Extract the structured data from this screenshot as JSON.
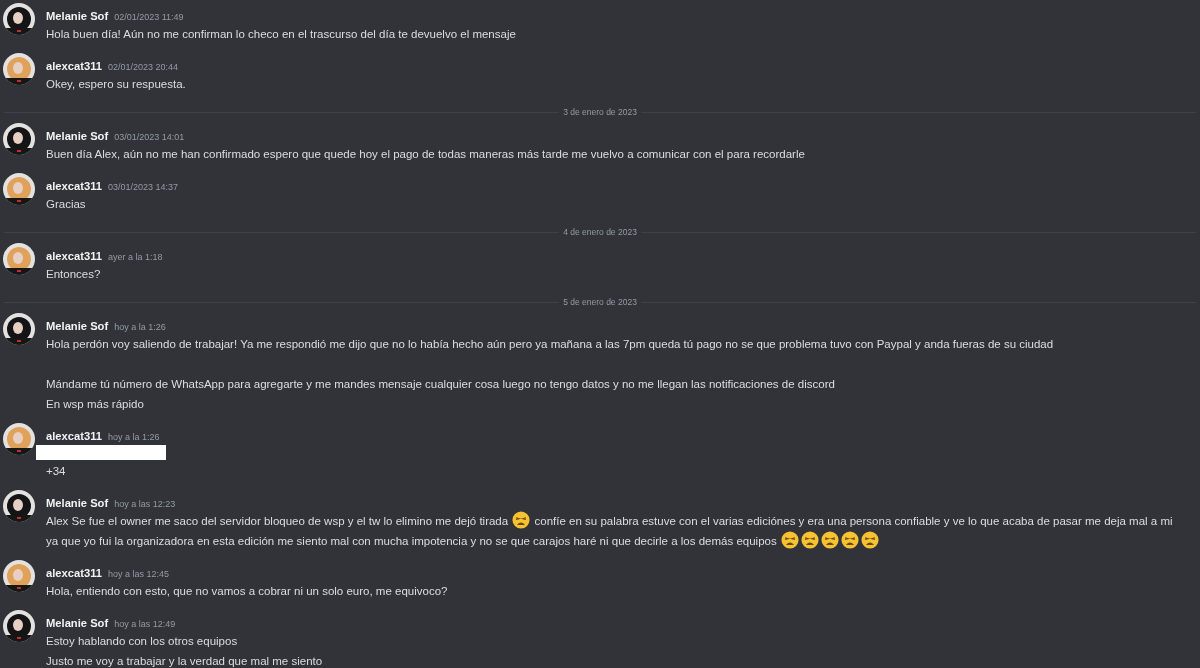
{
  "messages": [
    {
      "kind": "message",
      "author": "Melanie Sof",
      "avatar": {
        "kind": "picture",
        "color": "#141416"
      },
      "time": "02/01/2023 11:49",
      "blocks": [
        {
          "kind": "text",
          "parts": [
            {
              "kind": "text",
              "text": "Hola buen día! Aún no me confirman lo checo en el trascurso del día te devuelvo el mensaje"
            }
          ]
        }
      ]
    },
    {
      "kind": "message",
      "author": "alexcat311",
      "avatar": {
        "kind": "picture",
        "color": "#e0a15a"
      },
      "time": "02/01/2023 20:44",
      "blocks": [
        {
          "kind": "text",
          "parts": [
            {
              "kind": "text",
              "text": "Okey, espero su respuesta."
            }
          ]
        }
      ]
    },
    {
      "kind": "divider",
      "label": "3 de enero de 2023"
    },
    {
      "kind": "message",
      "author": "Melanie Sof",
      "avatar": {
        "kind": "picture",
        "color": "#141416"
      },
      "time": "03/01/2023 14:01",
      "blocks": [
        {
          "kind": "text",
          "parts": [
            {
              "kind": "text",
              "text": "Buen día Alex, aún no me han confirmado espero que quede hoy el pago de todas maneras más tarde me vuelvo a comunicar con el para recordarle"
            }
          ]
        }
      ]
    },
    {
      "kind": "message",
      "author": "alexcat311",
      "avatar": {
        "kind": "picture",
        "color": "#e0a15a"
      },
      "time": "03/01/2023 14:37",
      "blocks": [
        {
          "kind": "text",
          "parts": [
            {
              "kind": "text",
              "text": "Gracias"
            }
          ]
        }
      ]
    },
    {
      "kind": "divider",
      "label": "4 de enero de 2023"
    },
    {
      "kind": "message",
      "author": "alexcat311",
      "avatar": {
        "kind": "picture",
        "color": "#e0a15a"
      },
      "time": "ayer a la 1:18",
      "blocks": [
        {
          "kind": "text",
          "parts": [
            {
              "kind": "text",
              "text": "Entonces?"
            }
          ]
        }
      ]
    },
    {
      "kind": "divider",
      "label": "5 de enero de 2023"
    },
    {
      "kind": "message",
      "author": "Melanie Sof",
      "avatar": {
        "kind": "picture",
        "color": "#141416"
      },
      "time": "hoy a la 1:26",
      "blocks": [
        {
          "kind": "text",
          "parts": [
            {
              "kind": "text",
              "text": "Hola perdón voy saliendo de trabajar! Ya me respondió me dijo que no lo había hecho aún pero ya mañana a las 7pm queda tú pago no se que problema tuvo con Paypal y anda fueras de su ciudad\n\nMándame tú número de WhatsApp para agregarte y me mandes mensaje cualquier cosa luego no tengo datos y no me llegan las notificaciones de discord"
            }
          ]
        },
        {
          "kind": "text",
          "parts": [
            {
              "kind": "text",
              "text": "En wsp más rápido"
            }
          ]
        }
      ]
    },
    {
      "kind": "message",
      "author": "alexcat311",
      "avatar": {
        "kind": "picture",
        "color": "#e0a15a"
      },
      "time": "hoy a la 1:26",
      "blocks": [
        {
          "kind": "redacted"
        },
        {
          "kind": "text",
          "parts": [
            {
              "kind": "text",
              "text": "+34"
            }
          ]
        }
      ]
    },
    {
      "kind": "message",
      "author": "Melanie Sof",
      "avatar": {
        "kind": "picture",
        "color": "#141416"
      },
      "time": "hoy a las 12:23",
      "blocks": [
        {
          "kind": "text",
          "parts": [
            {
              "kind": "text",
              "text": "Alex Se fue el owner me saco del servidor bloqueo de wsp y el tw lo elimino me dejó tirada "
            },
            {
              "kind": "emoji"
            },
            {
              "kind": "text",
              "text": " confíe en su palabra estuve con el varias ediciónes y era una persona confiable y ve lo que acaba de pasar me deja mal a mi ya que yo fui la organizadora en esta edición me siento mal con mucha impotencia y no se que carajos haré ni que decirle a los demás equipos "
            },
            {
              "kind": "emoji"
            },
            {
              "kind": "emoji"
            },
            {
              "kind": "emoji"
            },
            {
              "kind": "emoji"
            },
            {
              "kind": "emoji"
            }
          ]
        }
      ]
    },
    {
      "kind": "message",
      "author": "alexcat311",
      "avatar": {
        "kind": "picture",
        "color": "#e0a15a"
      },
      "time": "hoy a las 12:45",
      "blocks": [
        {
          "kind": "text",
          "parts": [
            {
              "kind": "text",
              "text": "Hola, entiendo con esto, que no vamos a cobrar ni un solo euro, me equivoco?"
            }
          ]
        }
      ]
    },
    {
      "kind": "message",
      "author": "Melanie Sof",
      "avatar": {
        "kind": "picture",
        "color": "#141416"
      },
      "time": "hoy a las 12:49",
      "blocks": [
        {
          "kind": "text",
          "parts": [
            {
              "kind": "text",
              "text": "Estoy hablando con los otros equipos"
            }
          ]
        },
        {
          "kind": "text",
          "parts": [
            {
              "kind": "text",
              "text": "Justo me voy a trabajar y la verdad que mal me siento"
            }
          ]
        }
      ]
    }
  ]
}
